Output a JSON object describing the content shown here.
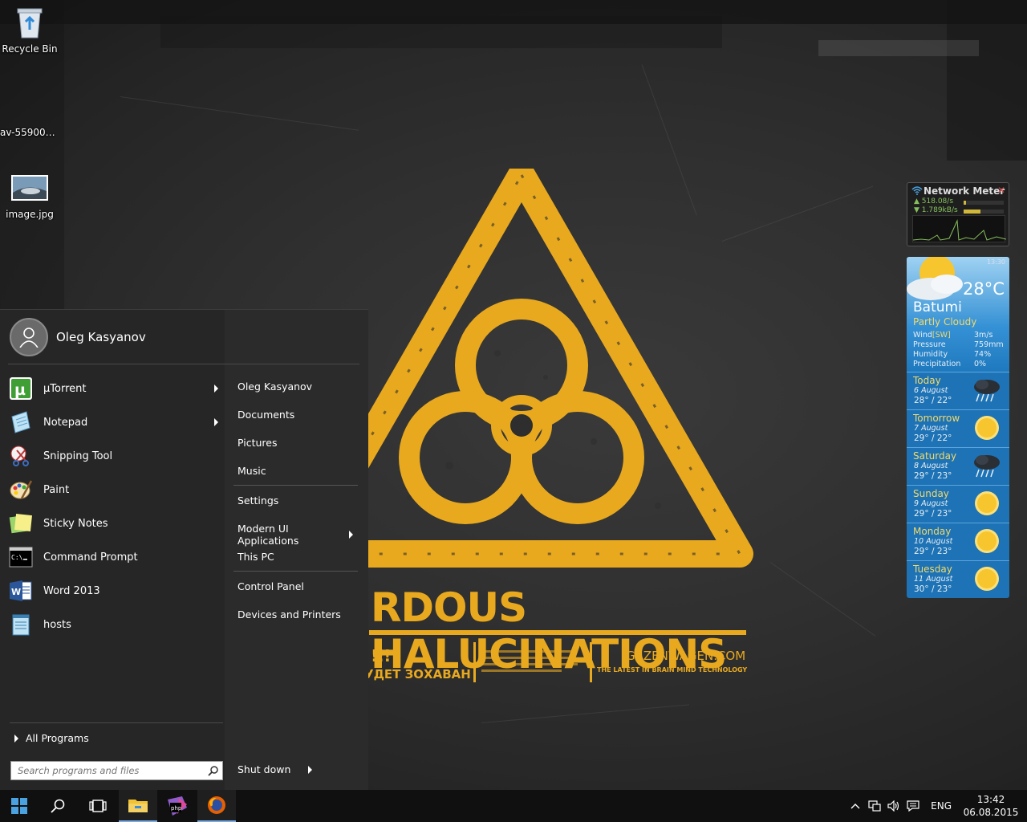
{
  "desktop": {
    "icons": [
      {
        "label": "Recycle Bin",
        "icon": "recycle-bin-icon"
      },
      {
        "label": "av-559006-...",
        "icon": "file-icon"
      },
      {
        "label": "image.jpg",
        "icon": "image-file-icon"
      }
    ],
    "wallpaper": {
      "headline": "RDOUS HALUCINATIONS",
      "left_top": "!!!",
      "left_bottom": "УДЕТ ЗОХАВАН",
      "site": "GAZENWAGEN.COM",
      "tagline": "THE LATEST IN BRAIN MIND TECHNOLOGY",
      "colors": {
        "accent": "#e8a91f",
        "background": "#2e2e2e"
      }
    }
  },
  "start_menu": {
    "user_name": "Oleg Kasyanov",
    "programs": [
      {
        "label": "µTorrent",
        "icon": "utorrent-icon",
        "has_submenu": true
      },
      {
        "label": "Notepad",
        "icon": "notepad-icon",
        "has_submenu": true
      },
      {
        "label": "Snipping Tool",
        "icon": "snipping-tool-icon",
        "has_submenu": false
      },
      {
        "label": "Paint",
        "icon": "paint-icon",
        "has_submenu": false
      },
      {
        "label": "Sticky Notes",
        "icon": "sticky-notes-icon",
        "has_submenu": false
      },
      {
        "label": "Command Prompt",
        "icon": "command-prompt-icon",
        "has_submenu": false
      },
      {
        "label": "Word 2013",
        "icon": "word-icon",
        "has_submenu": false
      },
      {
        "label": "hosts",
        "icon": "notepad-file-icon",
        "has_submenu": false
      }
    ],
    "places": [
      {
        "label": "Oleg Kasyanov"
      },
      {
        "label": "Documents"
      },
      {
        "label": "Pictures"
      },
      {
        "label": "Music"
      },
      {
        "label": "Settings"
      },
      {
        "label": "Modern UI Applications"
      },
      {
        "label": "This PC"
      },
      {
        "label": "Control Panel"
      },
      {
        "label": "Devices and Printers"
      }
    ],
    "all_programs": "All Programs",
    "search_placeholder": "Search programs and files",
    "shutdown": "Shut down"
  },
  "network_meter": {
    "title": "Network Meter",
    "upload": "518.08/s",
    "download": "1.789kB/s"
  },
  "weather": {
    "time": "13:30",
    "temperature": "28°C",
    "city": "Batumi",
    "condition": "Partly Cloudy",
    "details": [
      {
        "key": "Wind",
        "dir": "[SW]",
        "value": "3m/s"
      },
      {
        "key": "Pressure",
        "dir": "",
        "value": "759mm"
      },
      {
        "key": "Humidity",
        "dir": "",
        "value": "74%"
      },
      {
        "key": "Precipitation",
        "dir": "",
        "value": "0%"
      }
    ],
    "forecast": [
      {
        "day": "Today",
        "date": "6 August",
        "temps": "28° / 22°",
        "icon": "storm-cloud-icon"
      },
      {
        "day": "Tomorrow",
        "date": "7 August",
        "temps": "29° / 22°",
        "icon": "sun-icon"
      },
      {
        "day": "Saturday",
        "date": "8 August",
        "temps": "29° / 23°",
        "icon": "storm-cloud-icon"
      },
      {
        "day": "Sunday",
        "date": "9 August",
        "temps": "29° / 23°",
        "icon": "sun-icon"
      },
      {
        "day": "Monday",
        "date": "10 August",
        "temps": "29° / 23°",
        "icon": "sun-icon"
      },
      {
        "day": "Tuesday",
        "date": "11 August",
        "temps": "30° / 23°",
        "icon": "sun-icon"
      }
    ]
  },
  "taskbar": {
    "apps": [
      {
        "name": "start",
        "icon": "windows-logo-icon"
      },
      {
        "name": "search",
        "icon": "search-icon"
      },
      {
        "name": "task-view",
        "icon": "task-view-icon"
      },
      {
        "name": "file-explorer",
        "icon": "folder-icon"
      },
      {
        "name": "phpstorm",
        "icon": "phpstorm-icon"
      },
      {
        "name": "firefox",
        "icon": "firefox-icon"
      }
    ],
    "language": "ENG",
    "time": "13:42",
    "date": "06.08.2015"
  }
}
